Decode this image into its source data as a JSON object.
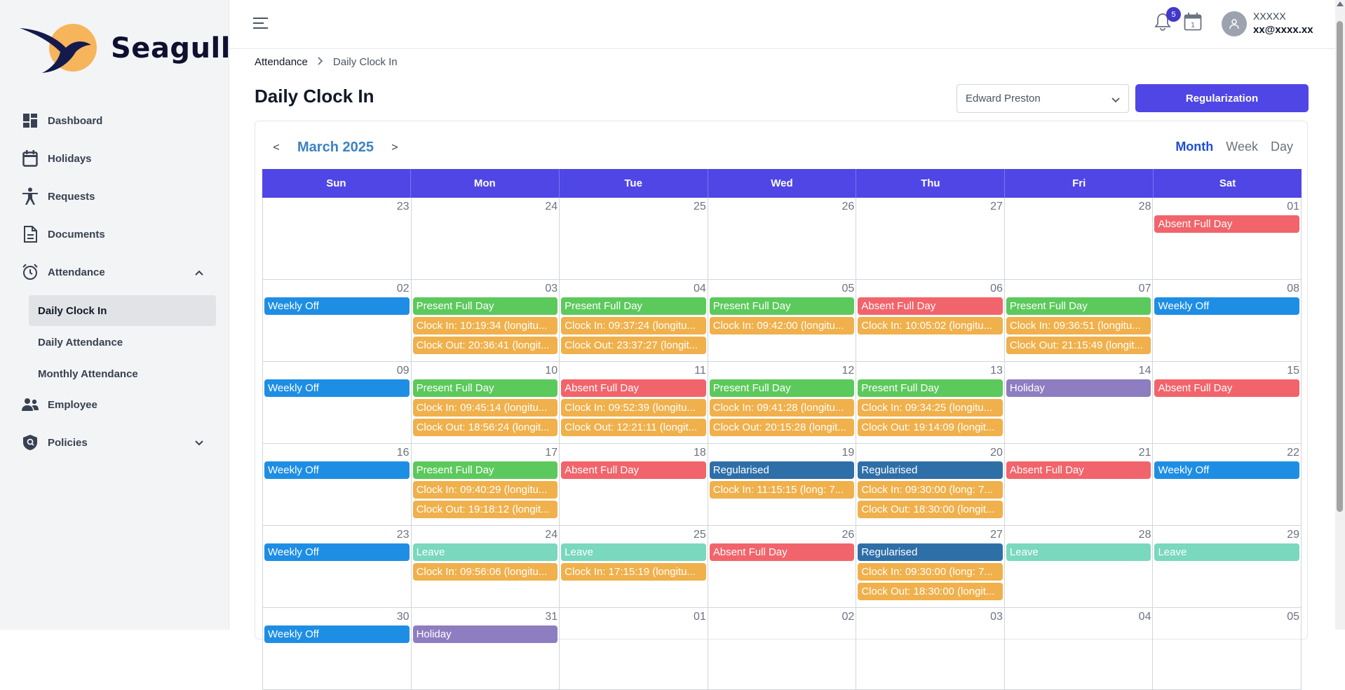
{
  "brand": {
    "name": "Seagull"
  },
  "sidebar": {
    "items": [
      {
        "label": "Dashboard",
        "icon": "dashboard-icon"
      },
      {
        "label": "Holidays",
        "icon": "calendar-icon"
      },
      {
        "label": "Requests",
        "icon": "person-icon"
      },
      {
        "label": "Documents",
        "icon": "document-icon"
      },
      {
        "label": "Attendance",
        "icon": "clock-icon"
      },
      {
        "label": "Employee",
        "icon": "people-icon"
      },
      {
        "label": "Policies",
        "icon": "shield-icon"
      }
    ],
    "attendance_sub": [
      {
        "label": "Daily Clock In"
      },
      {
        "label": "Daily Attendance"
      },
      {
        "label": "Monthly Attendance"
      }
    ]
  },
  "header": {
    "notif_count": "5",
    "user_name": "XXXXX",
    "user_email": "xx@xxxx.xx"
  },
  "breadcrumb": {
    "root": "Attendance",
    "current": "Daily Clock In"
  },
  "page": {
    "title": "Daily Clock In",
    "employee_select": "Edward Preston",
    "regularization_button": "Regularization"
  },
  "calendar": {
    "month_label": "March 2025",
    "prev": "<",
    "next": ">",
    "views": [
      "Month",
      "Week",
      "Day"
    ],
    "weekdays": [
      "Sun",
      "Mon",
      "Tue",
      "Wed",
      "Thu",
      "Fri",
      "Sat"
    ],
    "weeks": [
      [
        {
          "day": "23",
          "events": []
        },
        {
          "day": "24",
          "events": []
        },
        {
          "day": "25",
          "events": []
        },
        {
          "day": "26",
          "events": []
        },
        {
          "day": "27",
          "events": []
        },
        {
          "day": "28",
          "events": []
        },
        {
          "day": "01",
          "events": [
            {
              "label": "Absent Full Day",
              "type": "absent"
            }
          ]
        }
      ],
      [
        {
          "day": "02",
          "events": [
            {
              "label": "Weekly Off",
              "type": "weekly"
            }
          ]
        },
        {
          "day": "03",
          "events": [
            {
              "label": "Present Full Day",
              "type": "present"
            },
            {
              "label": "Clock In: 10:19:34 (longitu...",
              "type": "clock"
            },
            {
              "label": "Clock Out: 20:36:41 (longit...",
              "type": "clock"
            }
          ]
        },
        {
          "day": "04",
          "events": [
            {
              "label": "Present Full Day",
              "type": "present"
            },
            {
              "label": "Clock In: 09:37:24 (longitu...",
              "type": "clock"
            },
            {
              "label": "Clock Out: 23:37:27 (longit...",
              "type": "clock"
            }
          ]
        },
        {
          "day": "05",
          "events": [
            {
              "label": "Present Full Day",
              "type": "present"
            },
            {
              "label": "Clock In: 09:42:00 (longitu...",
              "type": "clock"
            }
          ]
        },
        {
          "day": "06",
          "events": [
            {
              "label": "Absent Full Day",
              "type": "absent"
            },
            {
              "label": "Clock In: 10:05:02 (longitu...",
              "type": "clock"
            }
          ]
        },
        {
          "day": "07",
          "events": [
            {
              "label": "Present Full Day",
              "type": "present"
            },
            {
              "label": "Clock In: 09:36:51 (longitu...",
              "type": "clock"
            },
            {
              "label": "Clock Out: 21:15:49 (longit...",
              "type": "clock"
            }
          ]
        },
        {
          "day": "08",
          "events": [
            {
              "label": "Weekly Off",
              "type": "weekly"
            }
          ]
        }
      ],
      [
        {
          "day": "09",
          "events": [
            {
              "label": "Weekly Off",
              "type": "weekly"
            }
          ]
        },
        {
          "day": "10",
          "events": [
            {
              "label": "Present Full Day",
              "type": "present"
            },
            {
              "label": "Clock In: 09:45:14 (longitu...",
              "type": "clock"
            },
            {
              "label": "Clock Out: 18:56:24 (longit...",
              "type": "clock"
            }
          ]
        },
        {
          "day": "11",
          "events": [
            {
              "label": "Absent Full Day",
              "type": "absent"
            },
            {
              "label": "Clock In: 09:52:39 (longitu...",
              "type": "clock"
            },
            {
              "label": "Clock Out: 12:21:11 (longit...",
              "type": "clock"
            }
          ]
        },
        {
          "day": "12",
          "events": [
            {
              "label": "Present Full Day",
              "type": "present"
            },
            {
              "label": "Clock In: 09:41:28 (longitu...",
              "type": "clock"
            },
            {
              "label": "Clock Out: 20:15:28 (longit...",
              "type": "clock"
            }
          ]
        },
        {
          "day": "13",
          "events": [
            {
              "label": "Present Full Day",
              "type": "present"
            },
            {
              "label": "Clock In: 09:34:25 (longitu...",
              "type": "clock"
            },
            {
              "label": "Clock Out: 19:14:09 (longit...",
              "type": "clock"
            }
          ]
        },
        {
          "day": "14",
          "events": [
            {
              "label": "Holiday",
              "type": "holiday"
            }
          ]
        },
        {
          "day": "15",
          "events": [
            {
              "label": "Absent Full Day",
              "type": "absent"
            }
          ]
        }
      ],
      [
        {
          "day": "16",
          "events": [
            {
              "label": "Weekly Off",
              "type": "weekly"
            }
          ]
        },
        {
          "day": "17",
          "events": [
            {
              "label": "Present Full Day",
              "type": "present"
            },
            {
              "label": "Clock In: 09:40:29 (longitu...",
              "type": "clock"
            },
            {
              "label": "Clock Out: 19:18:12 (longit...",
              "type": "clock"
            }
          ]
        },
        {
          "day": "18",
          "events": [
            {
              "label": "Absent Full Day",
              "type": "absent"
            }
          ]
        },
        {
          "day": "19",
          "events": [
            {
              "label": "Regularised",
              "type": "regularised"
            },
            {
              "label": "Clock In: 11:15:15 (long: 7...",
              "type": "clock"
            }
          ]
        },
        {
          "day": "20",
          "events": [
            {
              "label": "Regularised",
              "type": "regularised"
            },
            {
              "label": "Clock In: 09:30:00 (long: 7...",
              "type": "clock"
            },
            {
              "label": "Clock Out: 18:30:00 (longit...",
              "type": "clock"
            }
          ]
        },
        {
          "day": "21",
          "events": [
            {
              "label": "Absent Full Day",
              "type": "absent"
            }
          ]
        },
        {
          "day": "22",
          "events": [
            {
              "label": "Weekly Off",
              "type": "weekly"
            }
          ]
        }
      ],
      [
        {
          "day": "23",
          "events": [
            {
              "label": "Weekly Off",
              "type": "weekly"
            }
          ]
        },
        {
          "day": "24",
          "events": [
            {
              "label": "Leave",
              "type": "leave"
            },
            {
              "label": "Clock In: 09:56:06 (longitu...",
              "type": "clock"
            }
          ]
        },
        {
          "day": "25",
          "events": [
            {
              "label": "Leave",
              "type": "leave"
            },
            {
              "label": "Clock In: 17:15:19 (longitu...",
              "type": "clock"
            }
          ]
        },
        {
          "day": "26",
          "events": [
            {
              "label": "Absent Full Day",
              "type": "absent"
            }
          ]
        },
        {
          "day": "27",
          "events": [
            {
              "label": "Regularised",
              "type": "regularised"
            },
            {
              "label": "Clock In: 09:30:00 (long: 7...",
              "type": "clock"
            },
            {
              "label": "Clock Out: 18:30:00 (longit...",
              "type": "clock"
            }
          ]
        },
        {
          "day": "28",
          "events": [
            {
              "label": "Leave",
              "type": "leave"
            }
          ]
        },
        {
          "day": "29",
          "events": [
            {
              "label": "Leave",
              "type": "leave"
            }
          ]
        }
      ],
      [
        {
          "day": "30",
          "events": [
            {
              "label": "Weekly Off",
              "type": "weekly"
            }
          ]
        },
        {
          "day": "31",
          "events": [
            {
              "label": "Holiday",
              "type": "holiday"
            }
          ]
        },
        {
          "day": "01",
          "events": []
        },
        {
          "day": "02",
          "events": []
        },
        {
          "day": "03",
          "events": []
        },
        {
          "day": "04",
          "events": []
        },
        {
          "day": "05",
          "events": []
        }
      ]
    ]
  },
  "colors": {
    "primary": "#4f46e5",
    "present": "#5cc95c",
    "absent": "#f2646b",
    "weekly_off": "#1e8ee5",
    "holiday": "#8e7dc0",
    "regularised": "#2f6fa8",
    "leave": "#79d8bd",
    "clock": "#f0b04b"
  }
}
